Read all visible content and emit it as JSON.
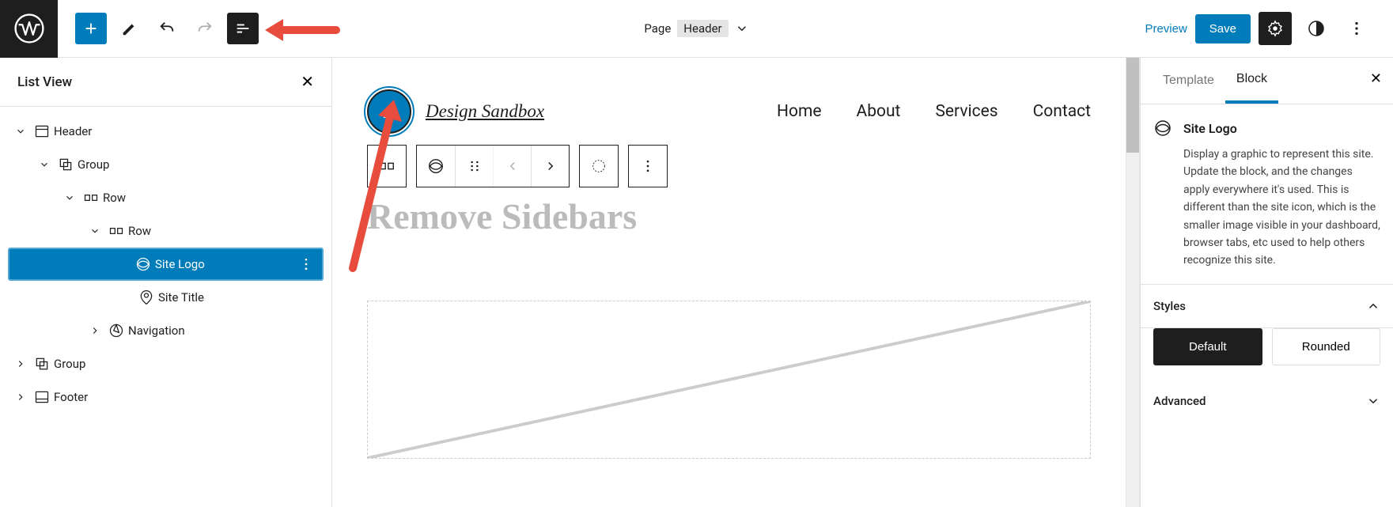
{
  "topbar": {
    "page_label": "Page",
    "template_name": "Header",
    "preview": "Preview",
    "save": "Save"
  },
  "left_panel": {
    "title": "List View",
    "tree": {
      "header": "Header",
      "group": "Group",
      "row1": "Row",
      "row2": "Row",
      "site_logo": "Site Logo",
      "site_title": "Site Title",
      "navigation": "Navigation",
      "group2": "Group",
      "footer": "Footer"
    }
  },
  "canvas": {
    "site_title": "Design Sandbox",
    "nav": {
      "home": "Home",
      "about": "About",
      "services": "Services",
      "contact": "Contact"
    },
    "page_title": "Remove Sidebars"
  },
  "right_panel": {
    "tab_template": "Template",
    "tab_block": "Block",
    "block_name": "Site Logo",
    "block_desc": "Display a graphic to represent this site. Update the block, and the changes apply everywhere it's used. This is different than the site icon, which is the smaller image visible in your dashboard, browser tabs, etc used to help others recognize this site.",
    "styles_label": "Styles",
    "style_default": "Default",
    "style_rounded": "Rounded",
    "advanced_label": "Advanced"
  }
}
